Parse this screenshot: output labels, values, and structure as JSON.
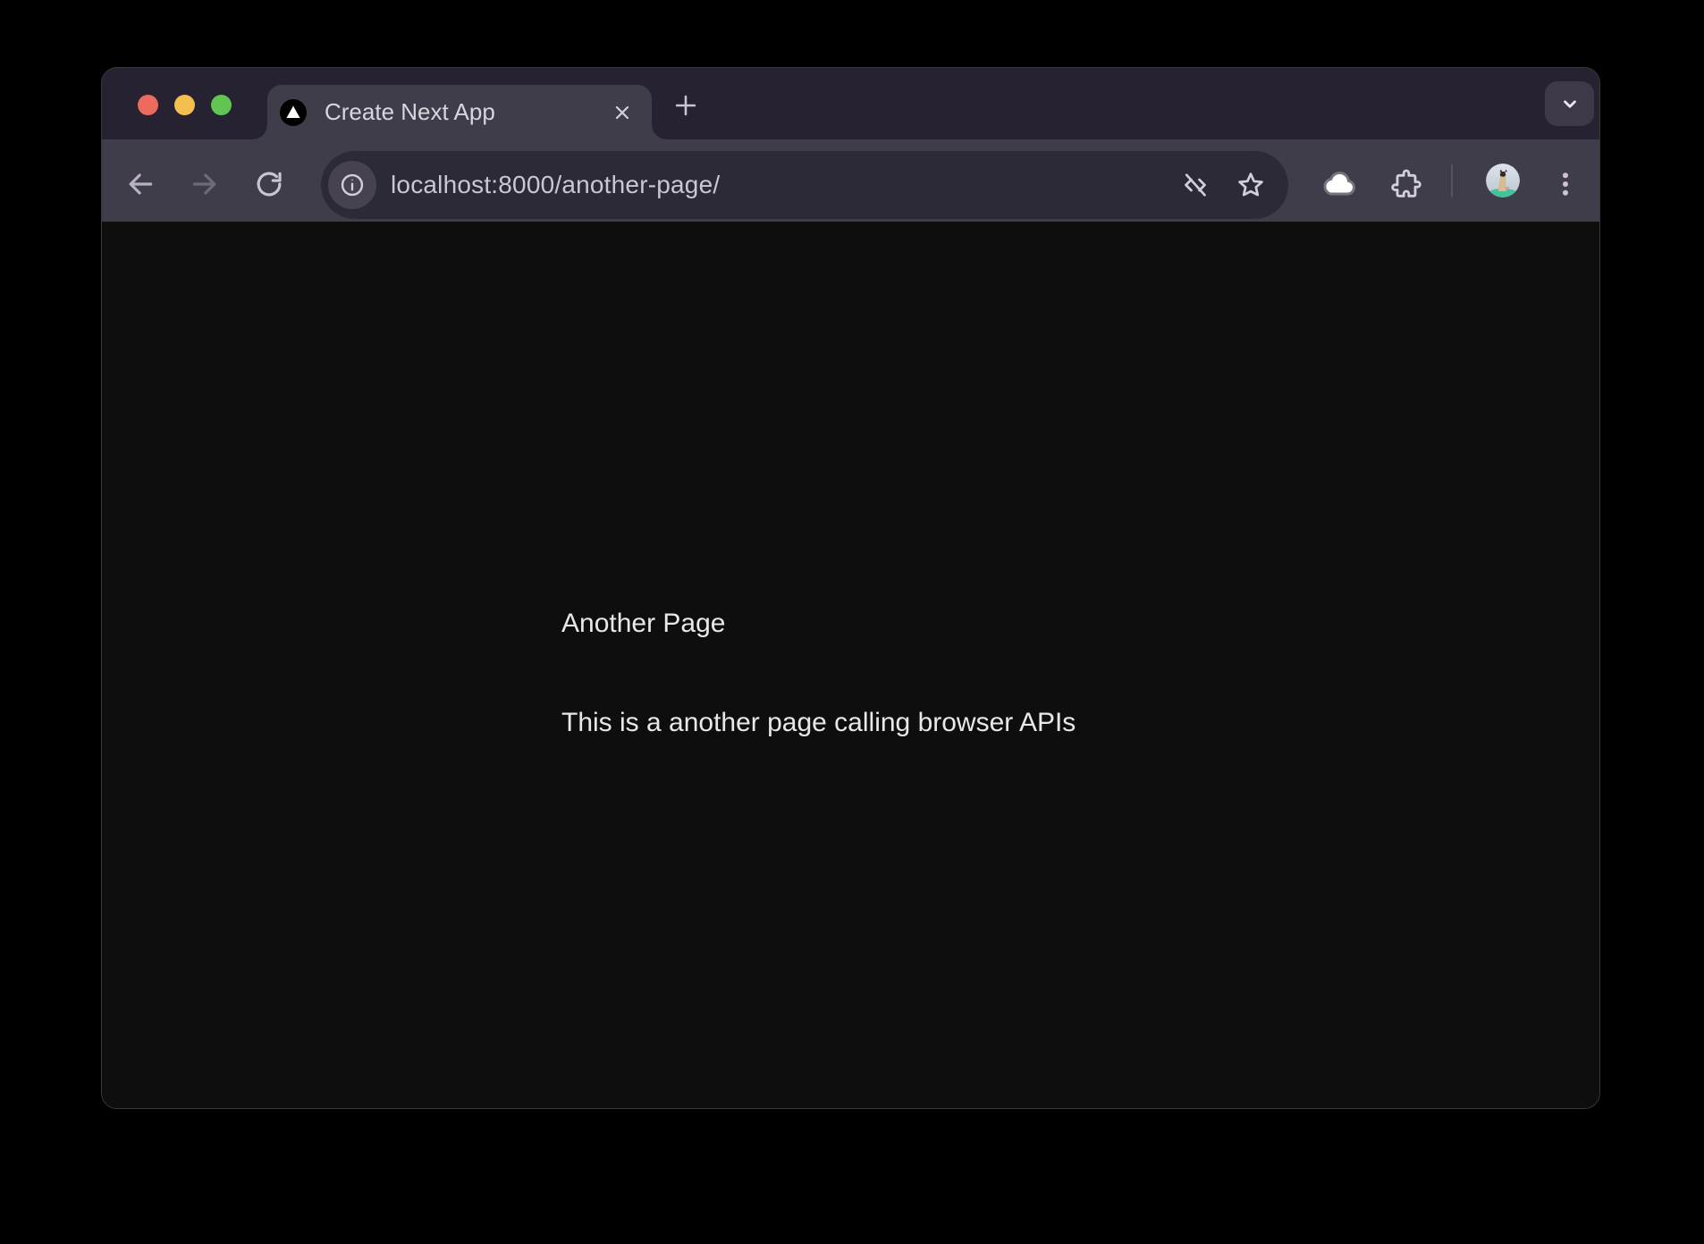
{
  "window": {
    "kind": "browser-window",
    "traffic_lights": [
      "close",
      "minimize",
      "zoom"
    ]
  },
  "tab": {
    "title": "Create Next App",
    "favicon": "nextjs-logo-icon"
  },
  "tabstrip": {
    "new_tab_icon": "plus-icon",
    "tab_search_icon": "chevron-down-icon"
  },
  "toolbar": {
    "back_icon": "arrow-left-icon",
    "forward_icon": "arrow-right-icon",
    "reload_icon": "reload-icon",
    "site_info_icon": "info-circle-icon",
    "url": "localhost:8000/another-page/",
    "omnibox_icons": [
      "code-off-icon",
      "bookmark-star-icon"
    ],
    "right_icons": [
      "cloud-icon",
      "extensions-puzzle-icon",
      "profile-avatar",
      "kebab-menu-icon"
    ]
  },
  "content": {
    "heading": "Another Page",
    "body": "This is a another page calling browser APIs"
  },
  "colors": {
    "outer_bg": "#000000",
    "tabstrip_bg": "#272231",
    "toolbar_bg": "#403d4b",
    "urlbar_bg": "#2d2a37",
    "page_bg": "#0e0e0e",
    "traffic_red": "#ed6a5e",
    "traffic_yellow": "#f5bf4f",
    "traffic_green": "#61c554",
    "icon_light": "#d2cfd9",
    "icon_dim": "#6e6a78",
    "text_light": "#d8d6dc",
    "url_text": "#cac7d1",
    "page_text": "#e8e8e8"
  }
}
